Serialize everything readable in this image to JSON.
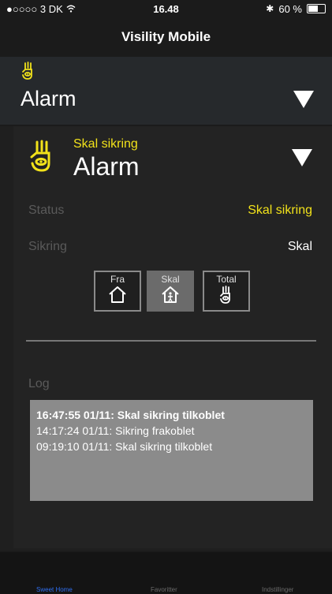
{
  "status_bar": {
    "carrier": "●○○○○ 3 DK",
    "time": "16.48",
    "battery": "60 %",
    "battery_level": 0.6
  },
  "nav": {
    "title": "Visility Mobile"
  },
  "section": {
    "title": "Alarm",
    "icon": "hand-eye-icon"
  },
  "item": {
    "subtitle": "Skal sikring",
    "title": "Alarm",
    "accent_color": "#f2e21a"
  },
  "status_row": {
    "label": "Status",
    "value": "Skal sikring"
  },
  "sikring_row": {
    "label": "Sikring",
    "value": "Skal"
  },
  "modes": [
    {
      "label": "Fra",
      "icon": "house-icon",
      "active": false
    },
    {
      "label": "Skal",
      "icon": "house-person-icon",
      "active": true
    },
    {
      "label": "Total",
      "icon": "hand-eye-icon",
      "active": false
    }
  ],
  "log": {
    "label": "Log",
    "entries": [
      "16:47:55 01/11: Skal sikring tilkoblet",
      "14:17:24 01/11: Sikring frakoblet",
      "09:19:10 01/11: Skal sikring tilkoblet"
    ]
  },
  "tabs": [
    {
      "label": "Sweet Home",
      "active": true
    },
    {
      "label": "Favoritter",
      "active": false
    },
    {
      "label": "Indstillinger",
      "active": false
    }
  ]
}
